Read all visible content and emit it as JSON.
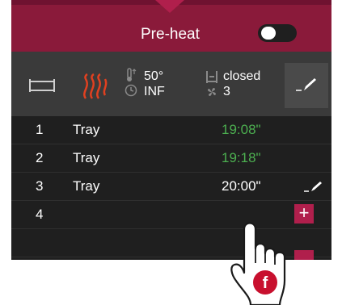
{
  "header": {
    "title": "Pre-heat",
    "toggle_on": false
  },
  "info": {
    "temperature": "50°",
    "time": "INF",
    "damper": "closed",
    "fan": "3",
    "heat_color": "#e04020"
  },
  "steps": [
    {
      "number": "1",
      "name": "Tray",
      "time": "19:08\"",
      "time_color": "#4caf50"
    },
    {
      "number": "2",
      "name": "Tray",
      "time": "19:18\"",
      "time_color": "#4caf50"
    },
    {
      "number": "3",
      "name": "Tray",
      "time": "20:00\"",
      "time_color": "#ffffff"
    },
    {
      "number": "4",
      "name": "",
      "time": "",
      "time_color": "#ffffff"
    }
  ],
  "overlay": {
    "badge_letter": "f",
    "badge_color": "#c8102e"
  }
}
